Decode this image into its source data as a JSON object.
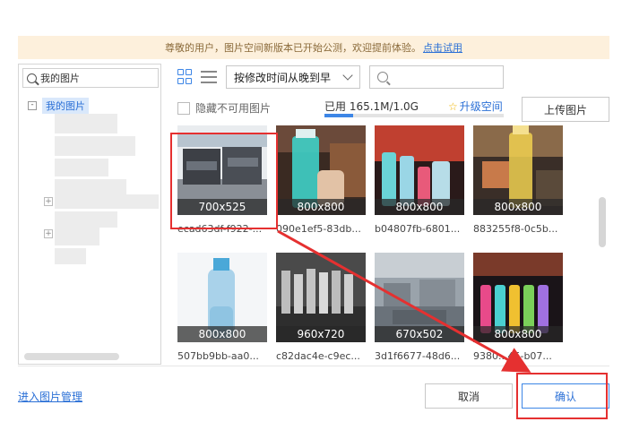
{
  "notice": {
    "text": "尊敬的用户，图片空间新版本已开始公测，欢迎提前体验。",
    "link": "点击试用"
  },
  "sidebar": {
    "search_placeholder": "我的图片",
    "root_label": "我的图片",
    "root_toggle": "-"
  },
  "toolbar": {
    "sort_value": "按修改时间从晚到早",
    "hide_unusable_label": "隐藏不可用图片",
    "usage_text": "已用 165.1M/1.0G",
    "usage_fraction": 0.161,
    "upgrade_label": "升级空间",
    "upload_label": "上传图片"
  },
  "images": [
    {
      "dim": "700x525",
      "name": "ecad63df-f922-...",
      "theme": "trucks"
    },
    {
      "dim": "800x800",
      "name": "090e1ef5-83db...",
      "theme": "teal-bottle"
    },
    {
      "dim": "800x800",
      "name": "b04807fb-6801...",
      "theme": "glass-cups"
    },
    {
      "dim": "800x800",
      "name": "883255f8-0c5b...",
      "theme": "cafe-bottle"
    },
    {
      "dim": "800x800",
      "name": "507bb9bb-aa0...",
      "theme": "blue-bottle"
    },
    {
      "dim": "960x720",
      "name": "c82dac4e-c9ec...",
      "theme": "bottles-bw"
    },
    {
      "dim": "670x502",
      "name": "3d1f6677-48d6...",
      "theme": "factory"
    },
    {
      "dim": "800x800",
      "name": "9380...45-b07...",
      "theme": "colorful-bottles"
    }
  ],
  "footer": {
    "manage_link": "进入图片管理",
    "cancel_label": "取消",
    "confirm_label": "确认"
  },
  "colors": {
    "accent": "#3d86e6",
    "annotation": "#e53030",
    "notice_bg": "#fdf0dc"
  },
  "icons": [
    "search-icon",
    "grid-view-icon",
    "list-view-icon",
    "chevron-down-icon",
    "star-icon"
  ]
}
